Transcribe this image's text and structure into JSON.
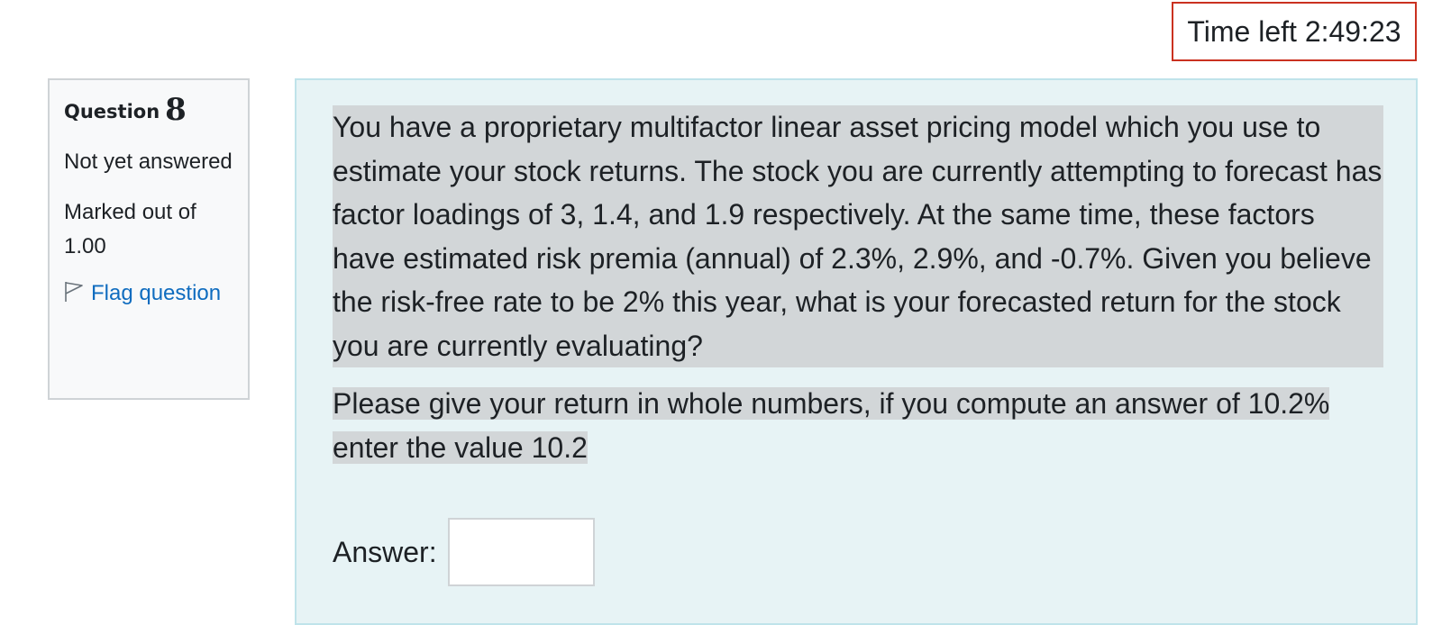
{
  "timer": {
    "label": "Time left 2:49:23"
  },
  "question_info": {
    "question_label": "Question",
    "question_number": "8",
    "state": "Not yet answered",
    "grade": "Marked out of 1.00",
    "flag_label": "Flag question",
    "flag_icon": "flag-icon"
  },
  "question": {
    "paragraph1": "You have a proprietary multifactor linear asset pricing model which you use to estimate your stock returns.  The stock you are currently attempting to forecast has factor loadings of 3, 1.4, and 1.9 respectively.  At the same time, these factors have estimated risk premia (annual) of 2.3%, 2.9%, and -0.7%.  Given you believe the risk-free rate to be 2% this year, what is your forecasted return for the stock you are currently evaluating?",
    "paragraph2": "Please give your return in whole numbers, if you compute an answer of 10.2% enter the value 10.2"
  },
  "answer": {
    "label": "Answer:",
    "value": ""
  },
  "colors": {
    "timer_border": "#ca3120",
    "content_background": "#e7f3f5",
    "content_border": "#bfe3ea",
    "info_background": "#f8f9fa",
    "link": "#0f6cbf",
    "selection_highlight": "#d2d6d8"
  }
}
